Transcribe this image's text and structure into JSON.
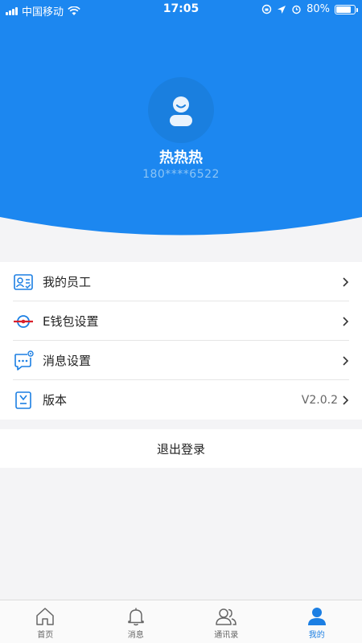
{
  "status_bar": {
    "carrier": "中国移动",
    "time": "17:05",
    "battery": "80%",
    "battery_level": 0.8
  },
  "profile": {
    "name": "热热热",
    "phone": "180****6522"
  },
  "menu": {
    "items": [
      {
        "label": "我的员工",
        "icon": "employee-card-icon"
      },
      {
        "label": "E钱包设置",
        "icon": "e-wallet-icon"
      },
      {
        "label": "消息设置",
        "icon": "message-settings-icon"
      },
      {
        "label": "版本",
        "icon": "version-icon",
        "value": "V2.0.2"
      }
    ]
  },
  "logout_label": "退出登录",
  "tabbar": {
    "tabs": [
      {
        "label": "首页",
        "icon": "home-icon"
      },
      {
        "label": "消息",
        "icon": "bell-icon"
      },
      {
        "label": "通讯录",
        "icon": "contacts-icon"
      },
      {
        "label": "我的",
        "icon": "profile-icon",
        "active": true
      }
    ]
  },
  "colors": {
    "primary": "#1c87f0",
    "avatar_bg": "#1a7fdf",
    "active_tab": "#1c7fe3",
    "page_bg": "#f4f4f6"
  }
}
